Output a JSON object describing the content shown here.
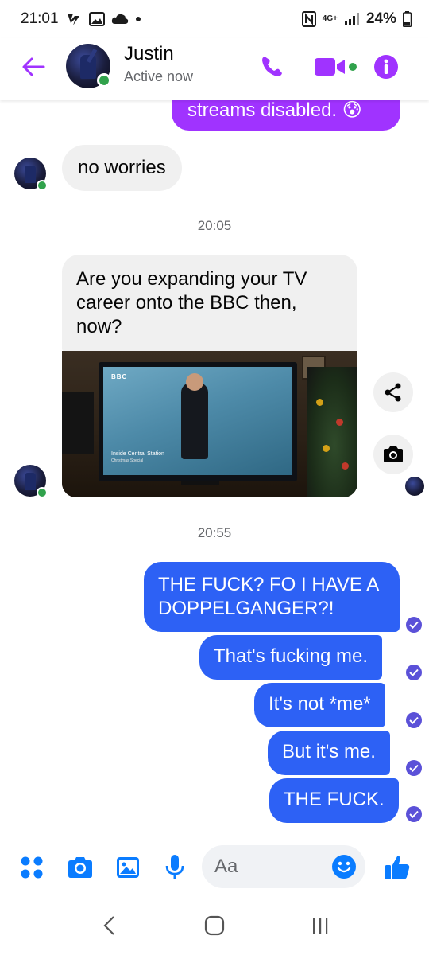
{
  "status_bar": {
    "time": "21:01",
    "network": "4G+",
    "battery": "24%"
  },
  "header": {
    "contact_name": "Justin",
    "contact_status": "Active now",
    "accent_color": "#a033ff",
    "icons": [
      "back-arrow-icon",
      "phone-icon",
      "video-camera-icon",
      "info-icon"
    ]
  },
  "messages": [
    {
      "id": "m1",
      "direction": "out",
      "text": "streams disabled. 😰"
    },
    {
      "id": "m2",
      "direction": "in",
      "text": "no worries"
    },
    {
      "id": "t1",
      "type": "timestamp",
      "text": "20:05"
    },
    {
      "id": "m3",
      "direction": "in",
      "text": "Are you expanding your TV career onto the BBC then, now?"
    },
    {
      "id": "m4",
      "direction": "in",
      "type": "photo",
      "photo_caption_lines": [
        "BBC",
        "Inside Central Station",
        "Christmas Special"
      ]
    },
    {
      "id": "t2",
      "type": "timestamp",
      "text": "20:55"
    },
    {
      "id": "m5",
      "direction": "out",
      "text": "THE FUCK? FO I HAVE A DOPPELGANGER?!"
    },
    {
      "id": "m6",
      "direction": "out",
      "text": "That's fucking me."
    },
    {
      "id": "m7",
      "direction": "out",
      "text": "It's not *me*"
    },
    {
      "id": "m8",
      "direction": "out",
      "text": "But it's me."
    },
    {
      "id": "m9",
      "direction": "out",
      "text": "THE FUCK."
    }
  ],
  "composer": {
    "placeholder": "Aa",
    "value": "",
    "accent_color": "#0a7cff"
  },
  "colors": {
    "outgoing_bubble": "#0a7cff",
    "incoming_bubble": "#f0f0f0",
    "online": "#31a24c",
    "read_receipt": "#5b51d8"
  }
}
